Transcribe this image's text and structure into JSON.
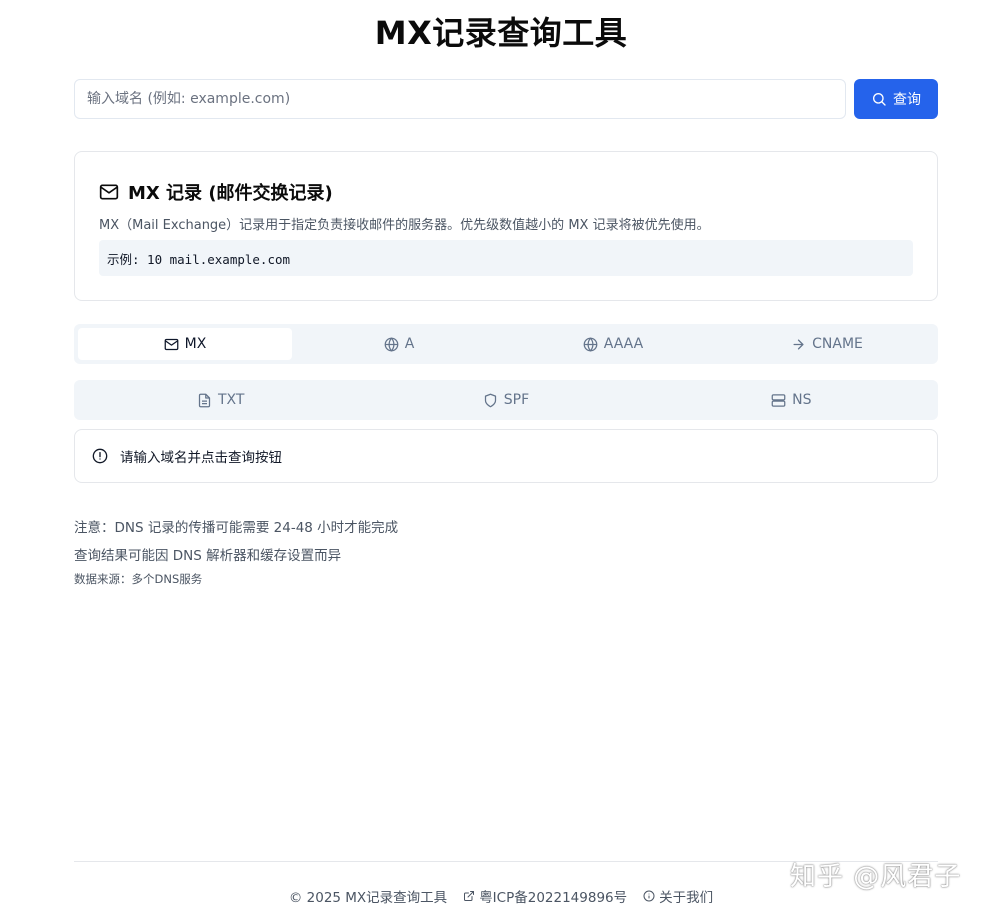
{
  "page": {
    "title": "MX记录查询工具"
  },
  "search": {
    "placeholder": "输入域名 (例如: example.com)",
    "value": "",
    "button_label": "查询"
  },
  "info": {
    "title": "MX 记录 (邮件交换记录)",
    "description": "MX（Mail Exchange）记录用于指定负责接收邮件的服务器。优先级数值越小的 MX 记录将被优先使用。",
    "example": "示例: 10 mail.example.com"
  },
  "tabs_row1": [
    {
      "label": "MX",
      "icon": "mail-icon",
      "active": true
    },
    {
      "label": "A",
      "icon": "globe-icon",
      "active": false
    },
    {
      "label": "AAAA",
      "icon": "globe-icon",
      "active": false
    },
    {
      "label": "CNAME",
      "icon": "arrow-right-icon",
      "active": false
    }
  ],
  "tabs_row2": [
    {
      "label": "TXT",
      "icon": "file-text-icon",
      "active": false
    },
    {
      "label": "SPF",
      "icon": "shield-icon",
      "active": false
    },
    {
      "label": "NS",
      "icon": "server-icon",
      "active": false
    }
  ],
  "alert": {
    "text": "请输入域名并点击查询按钮",
    "icon": "alert-circle-icon"
  },
  "notes": {
    "propagation": "注意：DNS 记录的传播可能需要 24-48 小时才能完成",
    "resolver": "查询结果可能因 DNS 解析器和缓存设置而异",
    "source": "数据来源：多个DNS服务"
  },
  "footer": {
    "copyright": "© 2025 MX记录查询工具",
    "icp": "粤ICP备2022149896号",
    "about": "关于我们"
  },
  "watermark": "知乎 @风君子",
  "colors": {
    "primary": "#2563eb",
    "tab_bg": "#f1f5f9",
    "border": "#e5e7eb"
  }
}
